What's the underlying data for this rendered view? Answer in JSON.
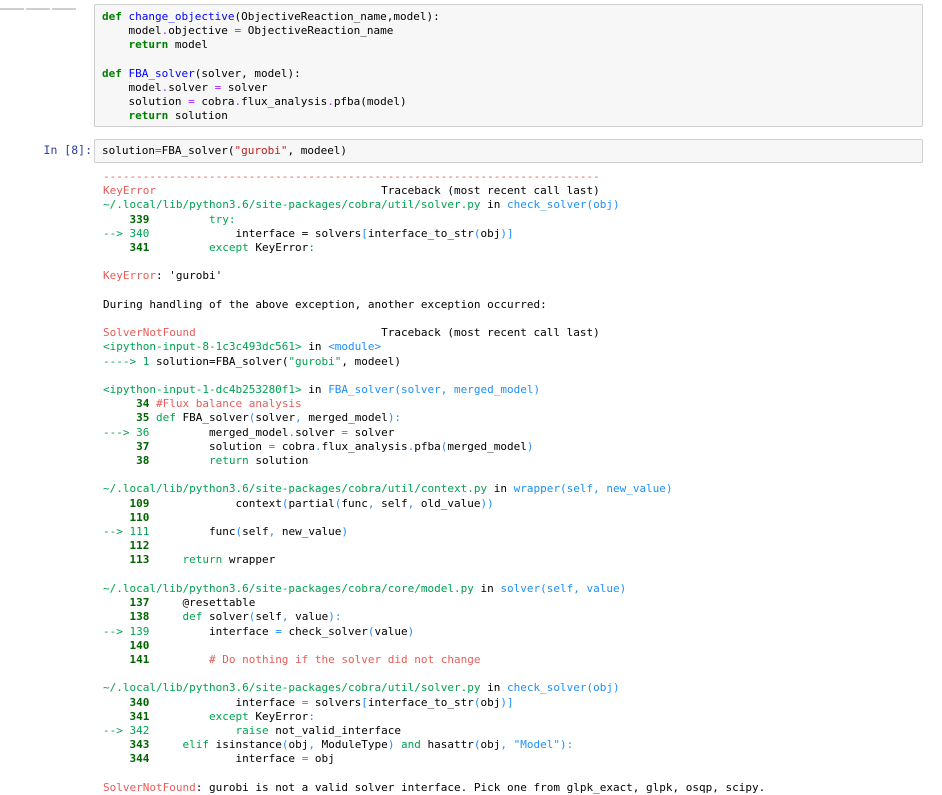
{
  "cell1": {
    "code_lines": [
      [
        {
          "t": "def ",
          "c": "kw"
        },
        {
          "t": "change_objective",
          "c": "fn"
        },
        {
          "t": "(ObjectiveReaction_name,model):",
          "c": ""
        }
      ],
      [
        {
          "t": "    model",
          "c": ""
        },
        {
          "t": ".",
          "c": "op"
        },
        {
          "t": "objective ",
          "c": ""
        },
        {
          "t": "=",
          "c": "op"
        },
        {
          "t": " ObjectiveReaction_name",
          "c": ""
        }
      ],
      [
        {
          "t": "    ",
          "c": ""
        },
        {
          "t": "return",
          "c": "kw"
        },
        {
          "t": " model",
          "c": ""
        }
      ],
      [
        {
          "t": "",
          "c": ""
        }
      ],
      [
        {
          "t": "def ",
          "c": "kw"
        },
        {
          "t": "FBA_solver",
          "c": "fn"
        },
        {
          "t": "(solver, model):",
          "c": ""
        }
      ],
      [
        {
          "t": "    model",
          "c": ""
        },
        {
          "t": ".",
          "c": "op"
        },
        {
          "t": "solver ",
          "c": ""
        },
        {
          "t": "=",
          "c": "op"
        },
        {
          "t": " solver",
          "c": ""
        }
      ],
      [
        {
          "t": "    solution ",
          "c": ""
        },
        {
          "t": "=",
          "c": "op"
        },
        {
          "t": " cobra",
          "c": ""
        },
        {
          "t": ".",
          "c": "op"
        },
        {
          "t": "flux_analysis",
          "c": ""
        },
        {
          "t": ".",
          "c": "op"
        },
        {
          "t": "pfba(model)",
          "c": ""
        }
      ],
      [
        {
          "t": "    ",
          "c": ""
        },
        {
          "t": "return",
          "c": "kw"
        },
        {
          "t": " solution",
          "c": ""
        }
      ]
    ]
  },
  "cell2": {
    "prompt": "In [8]:",
    "code_lines": [
      [
        {
          "t": "solution",
          "c": ""
        },
        {
          "t": "=",
          "c": "op"
        },
        {
          "t": "FBA_solver(",
          "c": ""
        },
        {
          "t": "\"gurobi\"",
          "c": "str"
        },
        {
          "t": ", modeel)",
          "c": ""
        }
      ]
    ]
  },
  "output_lines": [
    [
      {
        "t": "---------------------------------------------------------------------------",
        "c": "dash"
      }
    ],
    [
      {
        "t": "KeyError",
        "c": "ex"
      },
      {
        "t": "                                  Traceback (most recent call last)",
        "c": ""
      }
    ],
    [
      {
        "t": "~/.local/lib/python3.6/site-packages/cobra/util/solver.py",
        "c": "grn"
      },
      {
        "t": " in ",
        "c": ""
      },
      {
        "t": "check_solver",
        "c": "fnc"
      },
      {
        "t": "(obj)",
        "c": "fnc"
      }
    ],
    [
      {
        "t": "    339",
        "c": "ln"
      },
      {
        "t": "         try:",
        "c": "cur"
      }
    ],
    [
      {
        "t": "--> 340",
        "c": "grn"
      },
      {
        "t": "             interface = solvers",
        "c": ""
      },
      {
        "t": "[",
        "c": "fnc"
      },
      {
        "t": "interface_to_str",
        "c": ""
      },
      {
        "t": "(",
        "c": "fnc"
      },
      {
        "t": "obj",
        "c": ""
      },
      {
        "t": ")]",
        "c": "fnc"
      }
    ],
    [
      {
        "t": "    341",
        "c": "ln"
      },
      {
        "t": "         except",
        "c": "cur"
      },
      {
        "t": " KeyError",
        "c": ""
      },
      {
        "t": ":",
        "c": "cur"
      }
    ],
    [
      {
        "t": "",
        "c": ""
      }
    ],
    [
      {
        "t": "KeyError",
        "c": "ex"
      },
      {
        "t": ": 'gurobi'",
        "c": ""
      }
    ],
    [
      {
        "t": "",
        "c": ""
      }
    ],
    [
      {
        "t": "During handling of the above exception, another exception occurred:",
        "c": ""
      }
    ],
    [
      {
        "t": "",
        "c": ""
      }
    ],
    [
      {
        "t": "SolverNotFound",
        "c": "ex"
      },
      {
        "t": "                            Traceback (most recent call last)",
        "c": ""
      }
    ],
    [
      {
        "t": "<ipython-input-8-1c3c493dc561>",
        "c": "grn"
      },
      {
        "t": " in ",
        "c": ""
      },
      {
        "t": "<module>",
        "c": "fnc"
      }
    ],
    [
      {
        "t": "----> 1 ",
        "c": "grn"
      },
      {
        "t": "solution=FBA_solver(",
        "c": ""
      },
      {
        "t": "\"gurobi\"",
        "c": "cur"
      },
      {
        "t": ", modeel)",
        "c": ""
      }
    ],
    [
      {
        "t": "",
        "c": ""
      }
    ],
    [
      {
        "t": "<ipython-input-1-dc4b253280f1>",
        "c": "grn"
      },
      {
        "t": " in ",
        "c": ""
      },
      {
        "t": "FBA_solver",
        "c": "fnc"
      },
      {
        "t": "(solver, merged_model)",
        "c": "fnc"
      }
    ],
    [
      {
        "t": "     34 ",
        "c": "ln"
      },
      {
        "t": "#Flux balance analysis",
        "c": "cmt"
      }
    ],
    [
      {
        "t": "     35 ",
        "c": "ln"
      },
      {
        "t": "def",
        "c": "cur"
      },
      {
        "t": " FBA_solver",
        "c": ""
      },
      {
        "t": "(",
        "c": "fnc"
      },
      {
        "t": "solver",
        "c": ""
      },
      {
        "t": ",",
        "c": "fnc"
      },
      {
        "t": " merged_model",
        "c": ""
      },
      {
        "t": "):",
        "c": "fnc"
      }
    ],
    [
      {
        "t": "---> 36 ",
        "c": "grn"
      },
      {
        "t": "        merged_model",
        "c": ""
      },
      {
        "t": ".",
        "c": "fnc"
      },
      {
        "t": "solver ",
        "c": ""
      },
      {
        "t": "=",
        "c": "fnc"
      },
      {
        "t": " solver",
        "c": ""
      }
    ],
    [
      {
        "t": "     37 ",
        "c": "ln"
      },
      {
        "t": "        solution ",
        "c": ""
      },
      {
        "t": "=",
        "c": "fnc"
      },
      {
        "t": " cobra",
        "c": ""
      },
      {
        "t": ".",
        "c": "fnc"
      },
      {
        "t": "flux_analysis",
        "c": ""
      },
      {
        "t": ".",
        "c": "fnc"
      },
      {
        "t": "pfba",
        "c": ""
      },
      {
        "t": "(",
        "c": "fnc"
      },
      {
        "t": "merged_model",
        "c": ""
      },
      {
        "t": ")",
        "c": "fnc"
      }
    ],
    [
      {
        "t": "     38 ",
        "c": "ln"
      },
      {
        "t": "        ",
        "c": ""
      },
      {
        "t": "return",
        "c": "cur"
      },
      {
        "t": " solution",
        "c": ""
      }
    ],
    [
      {
        "t": "",
        "c": ""
      }
    ],
    [
      {
        "t": "~/.local/lib/python3.6/site-packages/cobra/util/context.py",
        "c": "grn"
      },
      {
        "t": " in ",
        "c": ""
      },
      {
        "t": "wrapper",
        "c": "fnc"
      },
      {
        "t": "(self, new_value)",
        "c": "fnc"
      }
    ],
    [
      {
        "t": "    109",
        "c": "ln"
      },
      {
        "t": "             context",
        "c": ""
      },
      {
        "t": "(",
        "c": "fnc"
      },
      {
        "t": "partial",
        "c": ""
      },
      {
        "t": "(",
        "c": "fnc"
      },
      {
        "t": "func",
        "c": ""
      },
      {
        "t": ",",
        "c": "fnc"
      },
      {
        "t": " self",
        "c": ""
      },
      {
        "t": ",",
        "c": "fnc"
      },
      {
        "t": " old_value",
        "c": ""
      },
      {
        "t": "))",
        "c": "fnc"
      }
    ],
    [
      {
        "t": "    110",
        "c": "ln"
      }
    ],
    [
      {
        "t": "--> 111",
        "c": "grn"
      },
      {
        "t": "         func",
        "c": ""
      },
      {
        "t": "(",
        "c": "fnc"
      },
      {
        "t": "self",
        "c": ""
      },
      {
        "t": ",",
        "c": "fnc"
      },
      {
        "t": " new_value",
        "c": ""
      },
      {
        "t": ")",
        "c": "fnc"
      }
    ],
    [
      {
        "t": "    112",
        "c": "ln"
      }
    ],
    [
      {
        "t": "    113",
        "c": "ln"
      },
      {
        "t": "     return",
        "c": "cur"
      },
      {
        "t": " wrapper",
        "c": ""
      }
    ],
    [
      {
        "t": "",
        "c": ""
      }
    ],
    [
      {
        "t": "~/.local/lib/python3.6/site-packages/cobra/core/model.py",
        "c": "grn"
      },
      {
        "t": " in ",
        "c": ""
      },
      {
        "t": "solver",
        "c": "fnc"
      },
      {
        "t": "(self, value)",
        "c": "fnc"
      }
    ],
    [
      {
        "t": "    137",
        "c": "ln"
      },
      {
        "t": "     @resettable",
        "c": ""
      }
    ],
    [
      {
        "t": "    138",
        "c": "ln"
      },
      {
        "t": "     def",
        "c": "cur"
      },
      {
        "t": " solver",
        "c": ""
      },
      {
        "t": "(",
        "c": "fnc"
      },
      {
        "t": "self",
        "c": ""
      },
      {
        "t": ",",
        "c": "fnc"
      },
      {
        "t": " value",
        "c": ""
      },
      {
        "t": "):",
        "c": "fnc"
      }
    ],
    [
      {
        "t": "--> 139",
        "c": "grn"
      },
      {
        "t": "         interface ",
        "c": ""
      },
      {
        "t": "=",
        "c": "fnc"
      },
      {
        "t": " check_solver",
        "c": ""
      },
      {
        "t": "(",
        "c": "fnc"
      },
      {
        "t": "value",
        "c": ""
      },
      {
        "t": ")",
        "c": "fnc"
      }
    ],
    [
      {
        "t": "    140",
        "c": "ln"
      }
    ],
    [
      {
        "t": "    141",
        "c": "ln"
      },
      {
        "t": "         # Do nothing if the solver did not change",
        "c": "cmt"
      }
    ],
    [
      {
        "t": "",
        "c": ""
      }
    ],
    [
      {
        "t": "~/.local/lib/python3.6/site-packages/cobra/util/solver.py",
        "c": "grn"
      },
      {
        "t": " in ",
        "c": ""
      },
      {
        "t": "check_solver",
        "c": "fnc"
      },
      {
        "t": "(obj)",
        "c": "fnc"
      }
    ],
    [
      {
        "t": "    340",
        "c": "ln"
      },
      {
        "t": "             interface ",
        "c": ""
      },
      {
        "t": "=",
        "c": "fnc"
      },
      {
        "t": " solvers",
        "c": ""
      },
      {
        "t": "[",
        "c": "fnc"
      },
      {
        "t": "interface_to_str",
        "c": ""
      },
      {
        "t": "(",
        "c": "fnc"
      },
      {
        "t": "obj",
        "c": ""
      },
      {
        "t": ")]",
        "c": "fnc"
      }
    ],
    [
      {
        "t": "    341",
        "c": "ln"
      },
      {
        "t": "         except",
        "c": "cur"
      },
      {
        "t": " KeyError",
        "c": ""
      },
      {
        "t": ":",
        "c": "fnc"
      }
    ],
    [
      {
        "t": "--> 342",
        "c": "grn"
      },
      {
        "t": "             raise",
        "c": "cur"
      },
      {
        "t": " not_valid_interface",
        "c": ""
      }
    ],
    [
      {
        "t": "    343",
        "c": "ln"
      },
      {
        "t": "     elif",
        "c": "cur"
      },
      {
        "t": " isinstance",
        "c": ""
      },
      {
        "t": "(",
        "c": "fnc"
      },
      {
        "t": "obj",
        "c": ""
      },
      {
        "t": ",",
        "c": "fnc"
      },
      {
        "t": " ModuleType",
        "c": ""
      },
      {
        "t": ")",
        "c": "fnc"
      },
      {
        "t": " and",
        "c": "cur"
      },
      {
        "t": " hasattr",
        "c": ""
      },
      {
        "t": "(",
        "c": "fnc"
      },
      {
        "t": "obj",
        "c": ""
      },
      {
        "t": ",",
        "c": "fnc"
      },
      {
        "t": " \"Model\"",
        "c": "fnc"
      },
      {
        "t": "):",
        "c": "fnc"
      }
    ],
    [
      {
        "t": "    344",
        "c": "ln"
      },
      {
        "t": "             interface ",
        "c": ""
      },
      {
        "t": "=",
        "c": "fnc"
      },
      {
        "t": " obj",
        "c": ""
      }
    ],
    [
      {
        "t": "",
        "c": ""
      }
    ],
    [
      {
        "t": "SolverNotFound",
        "c": "ex"
      },
      {
        "t": ": gurobi is not a valid solver interface. Pick one from glpk_exact, glpk, osqp, scipy.",
        "c": ""
      }
    ]
  ],
  "colors": {
    "prompt": "#303f9f",
    "keyword": "#008000",
    "function_name": "#0000ff",
    "exception": "#e75c58",
    "path_green": "#00a250",
    "cyan_blue": "#208ffb",
    "cell_bg": "#f7f7f7",
    "cell_border": "#cfcfcf"
  }
}
